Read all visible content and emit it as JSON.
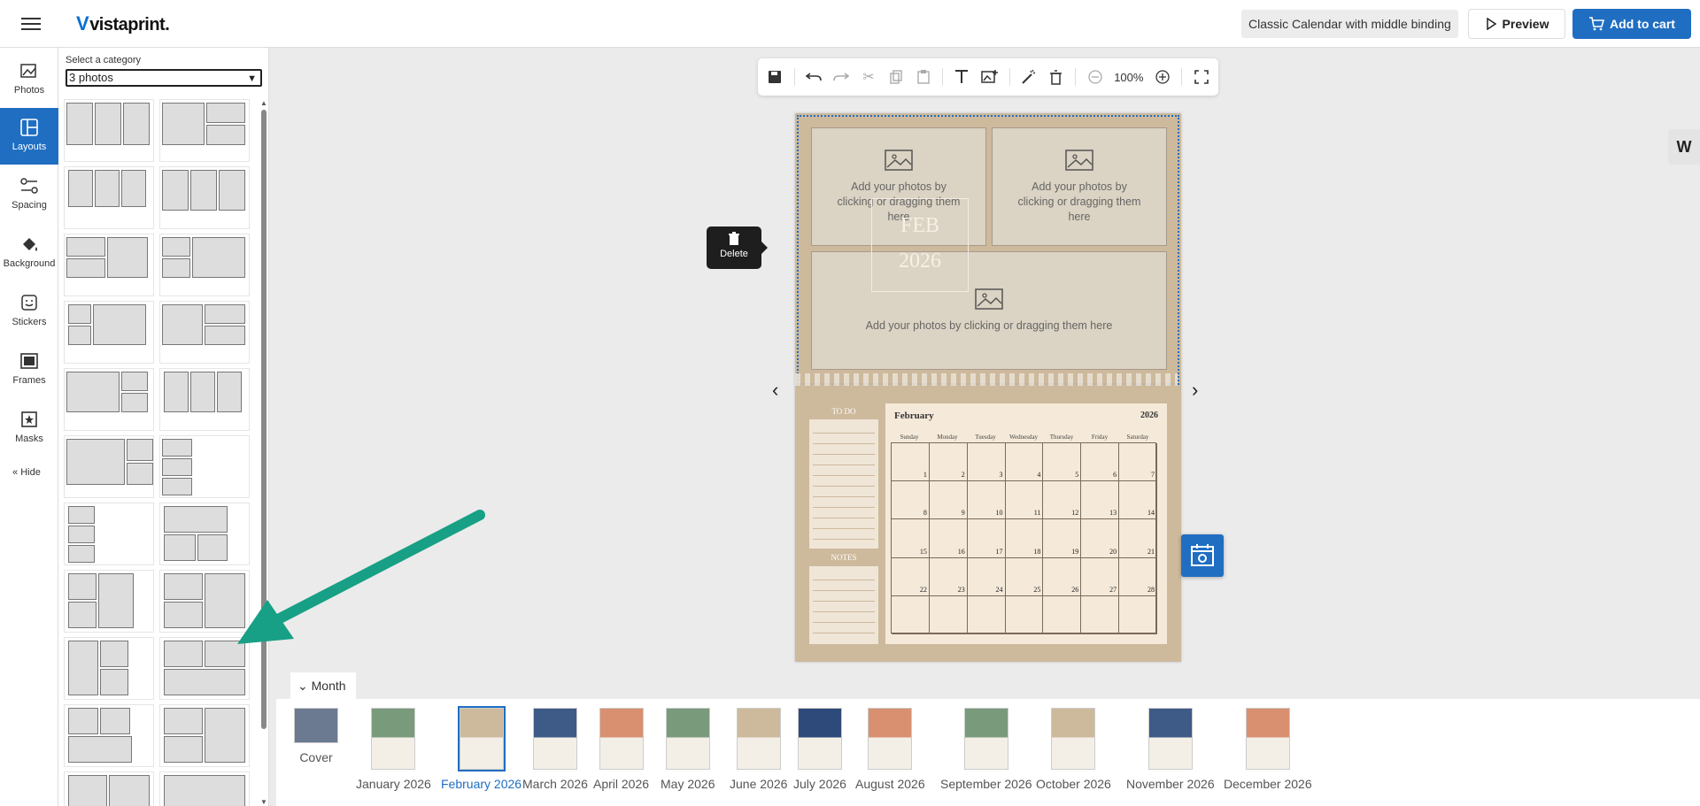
{
  "header": {
    "brand": "vistaprint.",
    "product_name": "Classic Calendar with middle binding",
    "preview_label": "Preview",
    "cart_label": "Add to cart",
    "accent": "#1f6ec2"
  },
  "rail": {
    "items": [
      {
        "label": "Photos",
        "icon": "photos-icon"
      },
      {
        "label": "Layouts",
        "icon": "layouts-icon"
      },
      {
        "label": "Spacing",
        "icon": "spacing-icon"
      },
      {
        "label": "Background",
        "icon": "paint-bucket-icon"
      },
      {
        "label": "Stickers",
        "icon": "sticker-icon"
      },
      {
        "label": "Frames",
        "icon": "frame-icon"
      },
      {
        "label": "Masks",
        "icon": "mask-icon"
      }
    ],
    "hide_label": "Hide"
  },
  "panel": {
    "label": "Select a category",
    "selected_category": "3 photos"
  },
  "toolbar": {
    "zoom": "100%"
  },
  "canvas": {
    "photo_prompt": "Add your photos by clicking or dragging them here",
    "month_overlay": "FEB",
    "year_overlay": "2026",
    "delete_label": "Delete",
    "todo_header": "TO DO",
    "notes_header": "NOTES",
    "cal_month": "February",
    "cal_year": "2026",
    "weekdays": [
      "Sunday",
      "Monday",
      "Tuesday",
      "Wednesday",
      "Thursday",
      "Friday",
      "Saturday"
    ]
  },
  "bottom": {
    "toggle_label": "Month",
    "thumbs": [
      {
        "label": "Cover",
        "color": "#6b7a90"
      },
      {
        "label": "January 2026",
        "color": "#7a9a7c"
      },
      {
        "label": "February 2026",
        "color": "#cdb99c"
      },
      {
        "label": "March 2026",
        "color": "#3e5a86"
      },
      {
        "label": "April 2026",
        "color": "#d99070"
      },
      {
        "label": "May 2026",
        "color": "#7a9a7c"
      },
      {
        "label": "June 2026",
        "color": "#cdb99c"
      },
      {
        "label": "July 2026",
        "color": "#2e4a7a"
      },
      {
        "label": "August 2026",
        "color": "#d99070"
      },
      {
        "label": "September 2026",
        "color": "#7a9a7c"
      },
      {
        "label": "October 2026",
        "color": "#cdb99c"
      },
      {
        "label": "November 2026",
        "color": "#3e5a86"
      },
      {
        "label": "December 2026",
        "color": "#d99070"
      }
    ],
    "selected_index": 2
  }
}
